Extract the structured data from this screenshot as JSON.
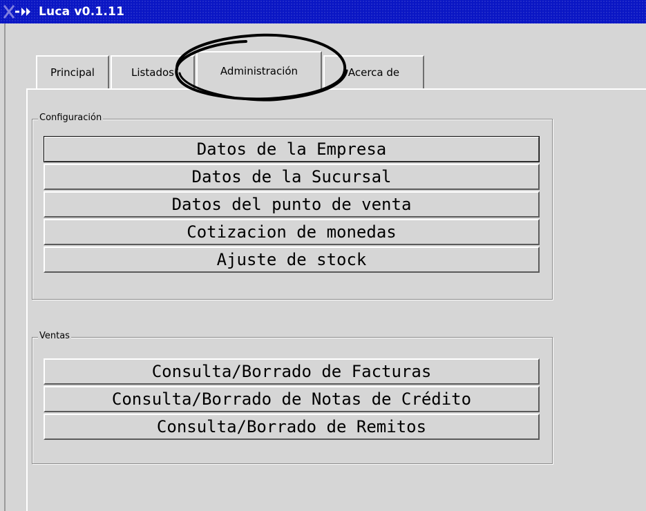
{
  "window": {
    "title": "Luca v0.1.11",
    "menu_icon": "x-window-menu-icon"
  },
  "tabs": [
    {
      "label": "Principal",
      "active": false
    },
    {
      "label": "Listados",
      "active": false
    },
    {
      "label": "Administración",
      "active": true
    },
    {
      "label": "Acerca de",
      "active": false
    }
  ],
  "annotation": {
    "shape": "hand-drawn ellipse",
    "target": "Administración",
    "color": "#000000"
  },
  "groups": {
    "configuracion": {
      "label": "Configuración",
      "buttons": [
        "Datos de la Empresa",
        "Datos de la Sucursal",
        "Datos del punto de venta",
        "Cotizacion de monedas",
        "Ajuste de stock"
      ]
    },
    "ventas": {
      "label": "Ventas",
      "buttons": [
        "Consulta/Borrado de Facturas",
        "Consulta/Borrado de Notas de Crédito",
        "Consulta/Borrado de Remitos"
      ]
    }
  },
  "colors": {
    "titlebar": "#0a16c4",
    "title_text": "#ffffff",
    "background": "#d6d6d6"
  }
}
